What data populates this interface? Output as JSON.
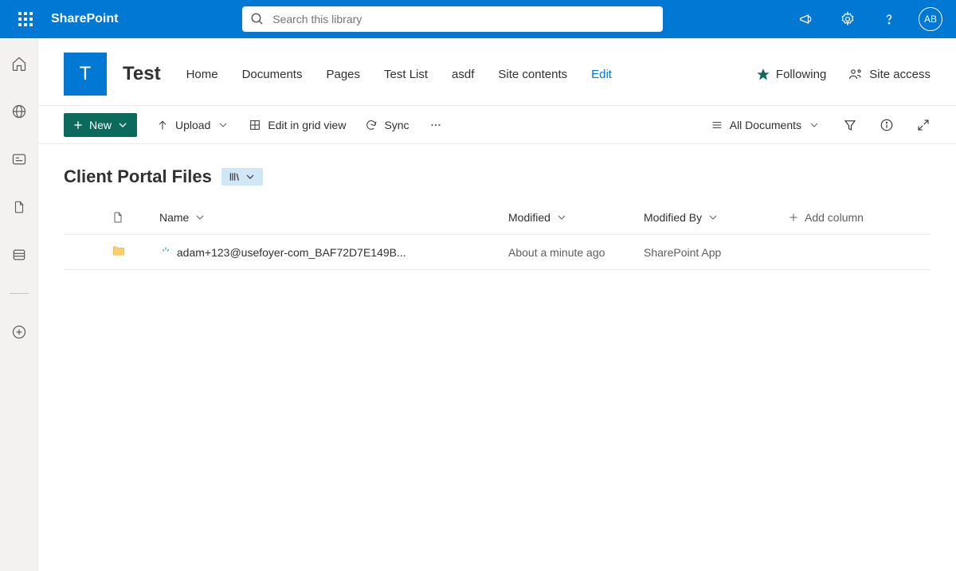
{
  "header": {
    "app_name": "SharePoint",
    "search_placeholder": "Search this library",
    "avatar_initials": "AB"
  },
  "site": {
    "logo_letter": "T",
    "title": "Test",
    "nav": [
      "Home",
      "Documents",
      "Pages",
      "Test List",
      "asdf",
      "Site contents"
    ],
    "nav_edit": "Edit",
    "following_label": "Following",
    "site_access_label": "Site access"
  },
  "commands": {
    "new_label": "New",
    "upload_label": "Upload",
    "edit_grid_label": "Edit in grid view",
    "sync_label": "Sync",
    "view_label": "All Documents"
  },
  "library": {
    "title": "Client Portal Files",
    "columns": {
      "name": "Name",
      "modified": "Modified",
      "modified_by": "Modified By",
      "add": "Add column"
    },
    "rows": [
      {
        "name": "adam+123@usefoyer-com_BAF72D7E149B...",
        "modified": "About a minute ago",
        "modified_by": "SharePoint App"
      }
    ]
  }
}
